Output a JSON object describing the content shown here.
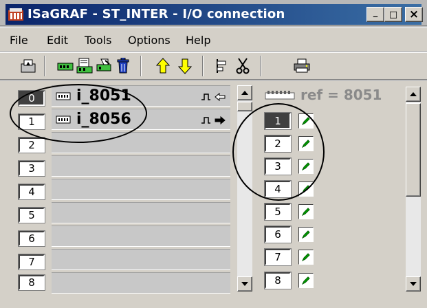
{
  "window": {
    "title": "ISaGRAF - ST_INTER - I/O connection",
    "minimize": "_",
    "maximize": "□",
    "close": "×"
  },
  "menu": [
    "File",
    "Edit",
    "Tools",
    "Options",
    "Help"
  ],
  "toolbar": {
    "buttons": [
      "open-icon",
      "board-icon",
      "edit-board-icon",
      "params-icon",
      "delete-icon",
      "up-arrow-icon",
      "down-arrow-icon",
      "align-icon",
      "cut-icon",
      "print-icon"
    ]
  },
  "slots": {
    "indices": [
      "0",
      "1",
      "2",
      "3",
      "4",
      "5",
      "6",
      "7",
      "8"
    ],
    "selected_index": "0",
    "boards": [
      {
        "slot": "0",
        "name": "i_8051",
        "direction": "input"
      },
      {
        "slot": "1",
        "name": "i_8056",
        "direction": "output"
      }
    ]
  },
  "channels": {
    "ref_label": "ref = 8051",
    "numbers": [
      "1",
      "2",
      "3",
      "4",
      "5",
      "6",
      "7",
      "8"
    ],
    "selected": "1"
  },
  "colors": {
    "title_gradient_start": "#0a246a",
    "title_gradient_end": "#3a6ea5",
    "face": "#d4d0c8",
    "edit_icon_green": "#00a000"
  }
}
